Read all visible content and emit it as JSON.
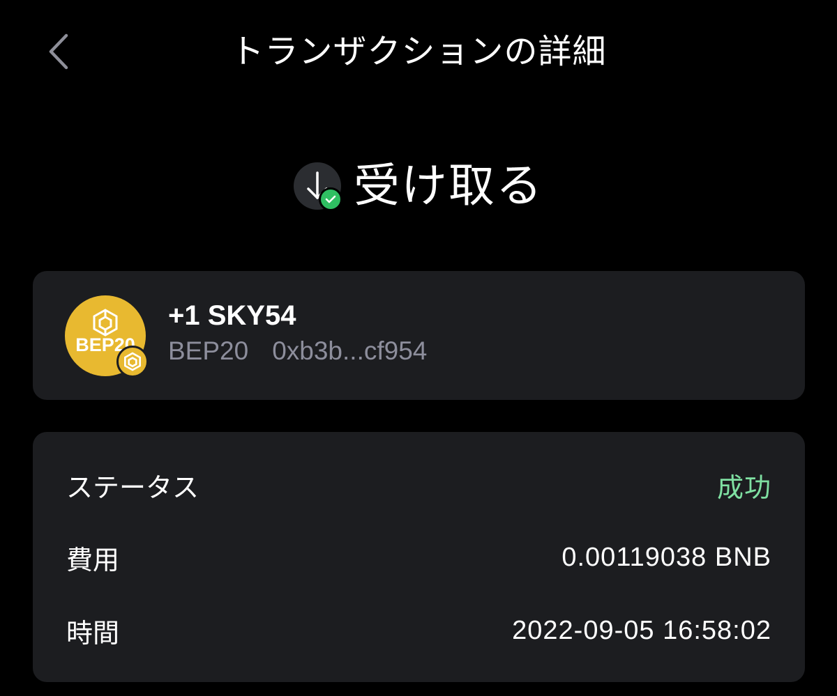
{
  "header": {
    "title": "トランザクションの詳細",
    "back_icon": "chevron-left-icon"
  },
  "transaction": {
    "type_label": "受け取る",
    "type_icon": "arrow-down-icon",
    "status_badge_icon": "check-icon",
    "status_badge_color": "#2fbf62"
  },
  "token": {
    "logo_text": "BEP20",
    "logo_color": "#e8b930",
    "amount": "+1 SKY54",
    "network": "BEP20",
    "address": "0xb3b...cf954"
  },
  "details": {
    "status_label": "ステータス",
    "status_value": "成功",
    "status_color": "#7fe0a2",
    "fee_label": "費用",
    "fee_value": "0.00119038 BNB",
    "time_label": "時間",
    "time_value": "2022-09-05 16:58:02"
  }
}
